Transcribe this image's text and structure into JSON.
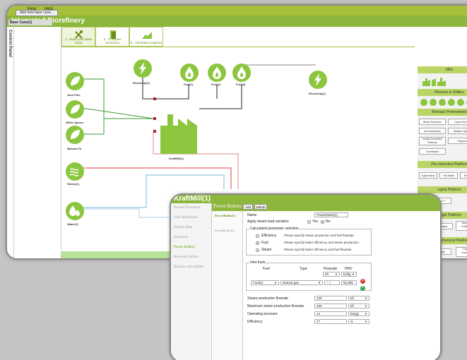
{
  "back": {
    "menu": [
      "View",
      "Help"
    ],
    "title": "Integrated Biorefinery",
    "vertical_panel": "Control Panel",
    "add_case": "Add new base case...",
    "base_case": "Base Case(1)",
    "steps": [
      "1 - Build your Base Case",
      "2 - Compare Scenarios",
      "3 - Generate Graphics"
    ],
    "nodes": {
      "jack_pine": "Jack Pine",
      "white_spruce": "White Spruce",
      "balsam_fir": "Balsam Fir",
      "steam": "Steam(1)",
      "water": "Water(1)",
      "electricity_in": "Electricity(1)",
      "fuel1": "Fuel(1)",
      "fuel2": "Fuel(2)",
      "fuel3": "Fuel(3)",
      "electricity_out": "Electricity(1)",
      "mill": "KraftMill(1)"
    },
    "library": {
      "mills": "Mills",
      "biomass_utilities": "Biomass & Utilities",
      "biomass_pretreatment": "Biomass Pretreatment",
      "pretreatment_items": [
        "Steam Explosion",
        "Liquid Hot Water",
        "Acid Hydrolysis",
        "Alkaline Hydrolysis",
        "Instant Controlled Pressure",
        "Organosolv",
        "Torrefaction"
      ],
      "preextraction": "Pre-extraction Platform",
      "preextraction_items": [
        "Supercritical",
        "Hot Water",
        "Enzymatic"
      ],
      "lignin": "Lignin Platform",
      "lignin_items": [
        "LignoBoost™"
      ],
      "sugar": "Sugar Platform",
      "sugar_items": [
        "Detoxification",
        "Separation Purification"
      ],
      "thermochemical": "Thermochemical Platform",
      "thermo_items": [
        "Syngas",
        "Catalytic Conversion"
      ]
    }
  },
  "front": {
    "title": "KraftMill(1)",
    "nav": [
      "Process Flowsheet",
      "Unit Information",
      "Process Data",
      "Economic",
      "Power Boilers",
      "Recovery Boilers",
      "Biomass and utilities"
    ],
    "sub_nav": [
      "PowerBoiler(1)",
      "PowerBoiler(1)"
    ],
    "section_title": "Power Boilers",
    "add_label": "Add",
    "delete_label": "Delete",
    "name_label": "Name",
    "name_value": "PowerBoiler(1)",
    "steam_variation_label": "Apply steam load variation",
    "yes": "Yes",
    "no": "No",
    "calc_group": "Calculated parameter selection",
    "calc_options": [
      {
        "name": "Efficiency",
        "desc": "Please specify steam production and fuel flowrate"
      },
      {
        "name": "Fuel",
        "desc": "Please specify boiler efficiency and steam production"
      },
      {
        "name": "Steam",
        "desc": "Please specify boiler efficiency and fuel flowrate"
      }
    ],
    "inlet_group": "Inlet fuels",
    "inlet_headers": {
      "fuel": "Fuel",
      "type": "Type",
      "flowrate": "Flowrate",
      "hhv": "HHV"
    },
    "flowrate_unit": "t/h",
    "hhv_unit": "kJ/kg",
    "inlet_row": {
      "fuel": "Fuel(1)",
      "type": "Natural gas",
      "flowrate": "7.2",
      "hhv": "52,999"
    },
    "params": [
      {
        "label": "Steam production flowrate",
        "value": "130",
        "unit": "t/h"
      },
      {
        "label": "Maximum steam production flowrate",
        "value": "150",
        "unit": "t/h"
      },
      {
        "label": "Operating pressure",
        "value": "12",
        "unit": "bar(g)"
      },
      {
        "label": "Efficiency",
        "value": "77",
        "unit": "%"
      }
    ]
  }
}
